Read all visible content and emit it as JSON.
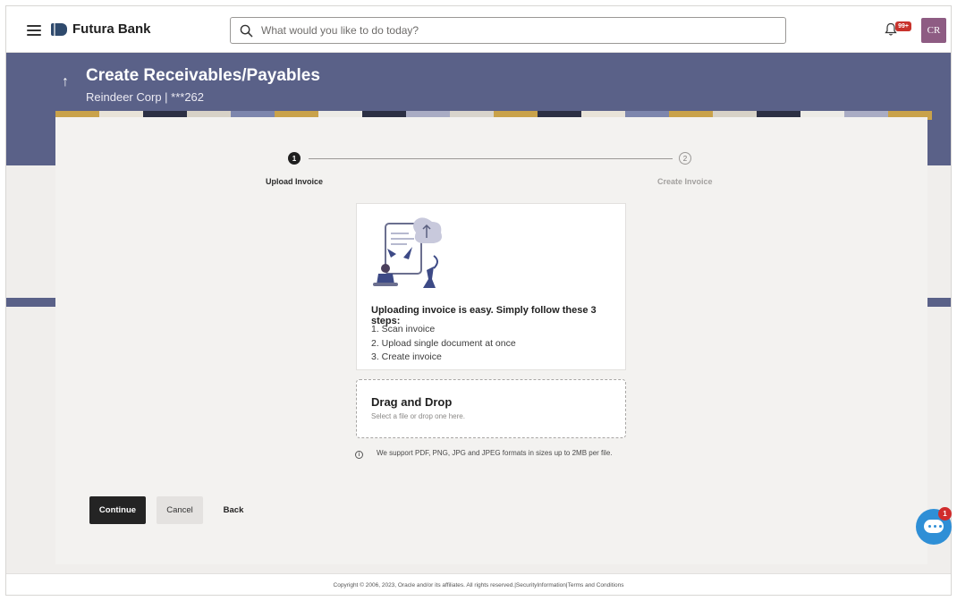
{
  "header": {
    "brand": "Futura Bank",
    "search_placeholder": "What would you like to do today?",
    "notification_badge": "99+",
    "avatar_initials": "CR"
  },
  "page": {
    "title": "Create Receivables/Payables",
    "subtitle": "Reindeer Corp | ***262"
  },
  "stepper": {
    "steps": [
      {
        "number": "1",
        "label": "Upload Invoice",
        "state": "active"
      },
      {
        "number": "2",
        "label": "Create Invoice",
        "state": "pending"
      }
    ]
  },
  "info": {
    "heading": "Uploading invoice is easy. Simply follow these 3 steps:",
    "steps": [
      "1. Scan invoice",
      "2. Upload single document at once",
      "3. Create invoice"
    ],
    "illustration_icon": "upload-document-illustration"
  },
  "upload": {
    "title": "Drag and Drop",
    "hint": "Select a file or drop one here.",
    "support_note": "We support PDF, PNG, JPG and JPEG formats in sizes up to 2MB per file.",
    "info_icon": "info-icon"
  },
  "actions": {
    "continue": "Continue",
    "cancel": "Cancel",
    "back": "Back"
  },
  "chat": {
    "badge": "1",
    "icon": "chat-icon"
  },
  "footer": {
    "text": "Copyright © 2006, 2023, Oracle and/or its affiliates. All rights reserved.|SecurityInformation|Terms and Conditions"
  },
  "colors": {
    "banner": "#5a6188",
    "primary_button": "#242424",
    "badge": "#c8332c",
    "avatar": "#8e5c83",
    "chat": "#2f8fd6"
  }
}
